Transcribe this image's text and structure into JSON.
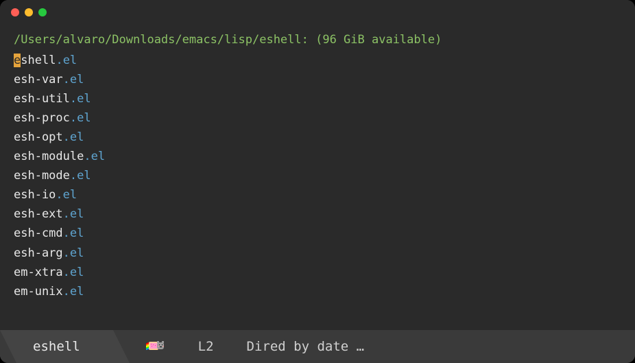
{
  "titlebar": {
    "traffic_lights": [
      "close",
      "minimize",
      "maximize"
    ]
  },
  "header": {
    "path": "/Users/alvaro/Downloads/emacs/lisp/eshell:",
    "available": " (96 GiB available)"
  },
  "files": [
    {
      "base": "eshell",
      "ext": "el",
      "cursor_char": "e",
      "rest": "shell"
    },
    {
      "base": "esh-var",
      "ext": "el"
    },
    {
      "base": "esh-util",
      "ext": "el"
    },
    {
      "base": "esh-proc",
      "ext": "el"
    },
    {
      "base": "esh-opt",
      "ext": "el"
    },
    {
      "base": "esh-module",
      "ext": "el"
    },
    {
      "base": "esh-mode",
      "ext": "el"
    },
    {
      "base": "esh-io",
      "ext": "el"
    },
    {
      "base": "esh-ext",
      "ext": "el"
    },
    {
      "base": "esh-cmd",
      "ext": "el"
    },
    {
      "base": "esh-arg",
      "ext": "el"
    },
    {
      "base": "em-xtra",
      "ext": "el"
    },
    {
      "base": "em-unix",
      "ext": "el"
    }
  ],
  "modeline": {
    "buffer_name": "eshell",
    "line": "L2",
    "mode": "Dired by date …"
  },
  "colors": {
    "background": "#2a2a2a",
    "header_green": "#8cc265",
    "ext_blue": "#5fa5d1",
    "cursor_bg": "#e6a43c",
    "modeline_bg": "#3a3a3a",
    "tab_bg": "#444444"
  }
}
